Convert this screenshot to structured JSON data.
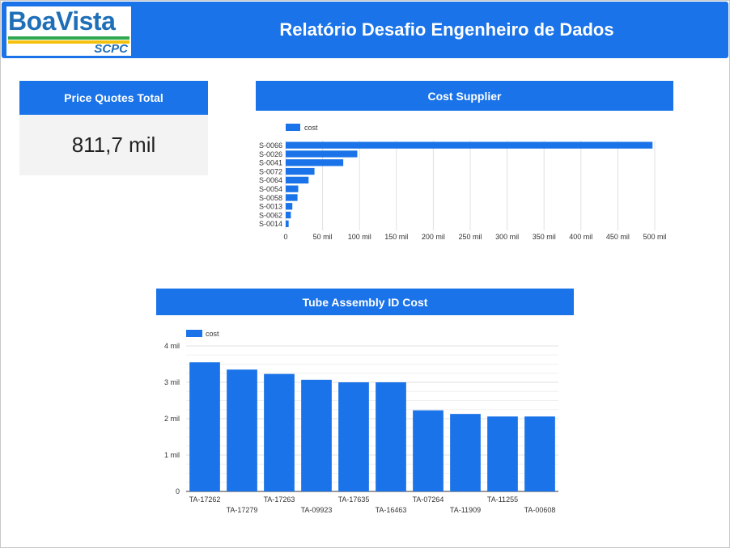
{
  "header": {
    "logo_text": "BoaVista",
    "logo_subtext": "SCPC",
    "title": "Relatório Desafio Engenheiro de Dados"
  },
  "kpi": {
    "title": "Price Quotes Total",
    "value": "811,7 mil"
  },
  "colors": {
    "accent": "#1a73e8",
    "bar": "#1a73e8",
    "grid": "#e0e0e0",
    "kpi_bg": "#f3f3f3"
  },
  "chart_data": [
    {
      "type": "bar",
      "orientation": "horizontal",
      "title": "Cost Supplier",
      "legend": "cost",
      "categories": [
        "S-0066",
        "S-0026",
        "S-0041",
        "S-0072",
        "S-0064",
        "S-0054",
        "S-0058",
        "S-0013",
        "S-0062",
        "S-0014"
      ],
      "values": [
        497000,
        97000,
        78000,
        39000,
        31000,
        17000,
        16000,
        9000,
        7000,
        4000
      ],
      "xlim": [
        0,
        500000
      ],
      "ticks": [
        0,
        50000,
        100000,
        150000,
        200000,
        250000,
        300000,
        350000,
        400000,
        450000,
        500000
      ],
      "tick_labels": [
        "0",
        "50 mil",
        "100 mil",
        "150 mil",
        "200 mil",
        "250 mil",
        "300 mil",
        "350 mil",
        "400 mil",
        "450 mil",
        "500 mil"
      ],
      "grid": true,
      "legend_position": "top-left"
    },
    {
      "type": "bar",
      "orientation": "vertical",
      "title": "Tube Assembly ID Cost",
      "legend": "cost",
      "categories": [
        "TA-17262",
        "TA-17279",
        "TA-17263",
        "TA-09923",
        "TA-17635",
        "TA-16463",
        "TA-07264",
        "TA-11909",
        "TA-11255",
        "TA-00608"
      ],
      "values": [
        3550,
        3350,
        3230,
        3070,
        3000,
        3000,
        2230,
        2130,
        2060,
        2060
      ],
      "ylim": [
        0,
        4000
      ],
      "ticks": [
        0,
        1000,
        2000,
        3000,
        4000
      ],
      "tick_labels": [
        "0",
        "1 mil",
        "2 mil",
        "3 mil",
        "4 mil"
      ],
      "grid": true,
      "legend_position": "top-left"
    }
  ]
}
